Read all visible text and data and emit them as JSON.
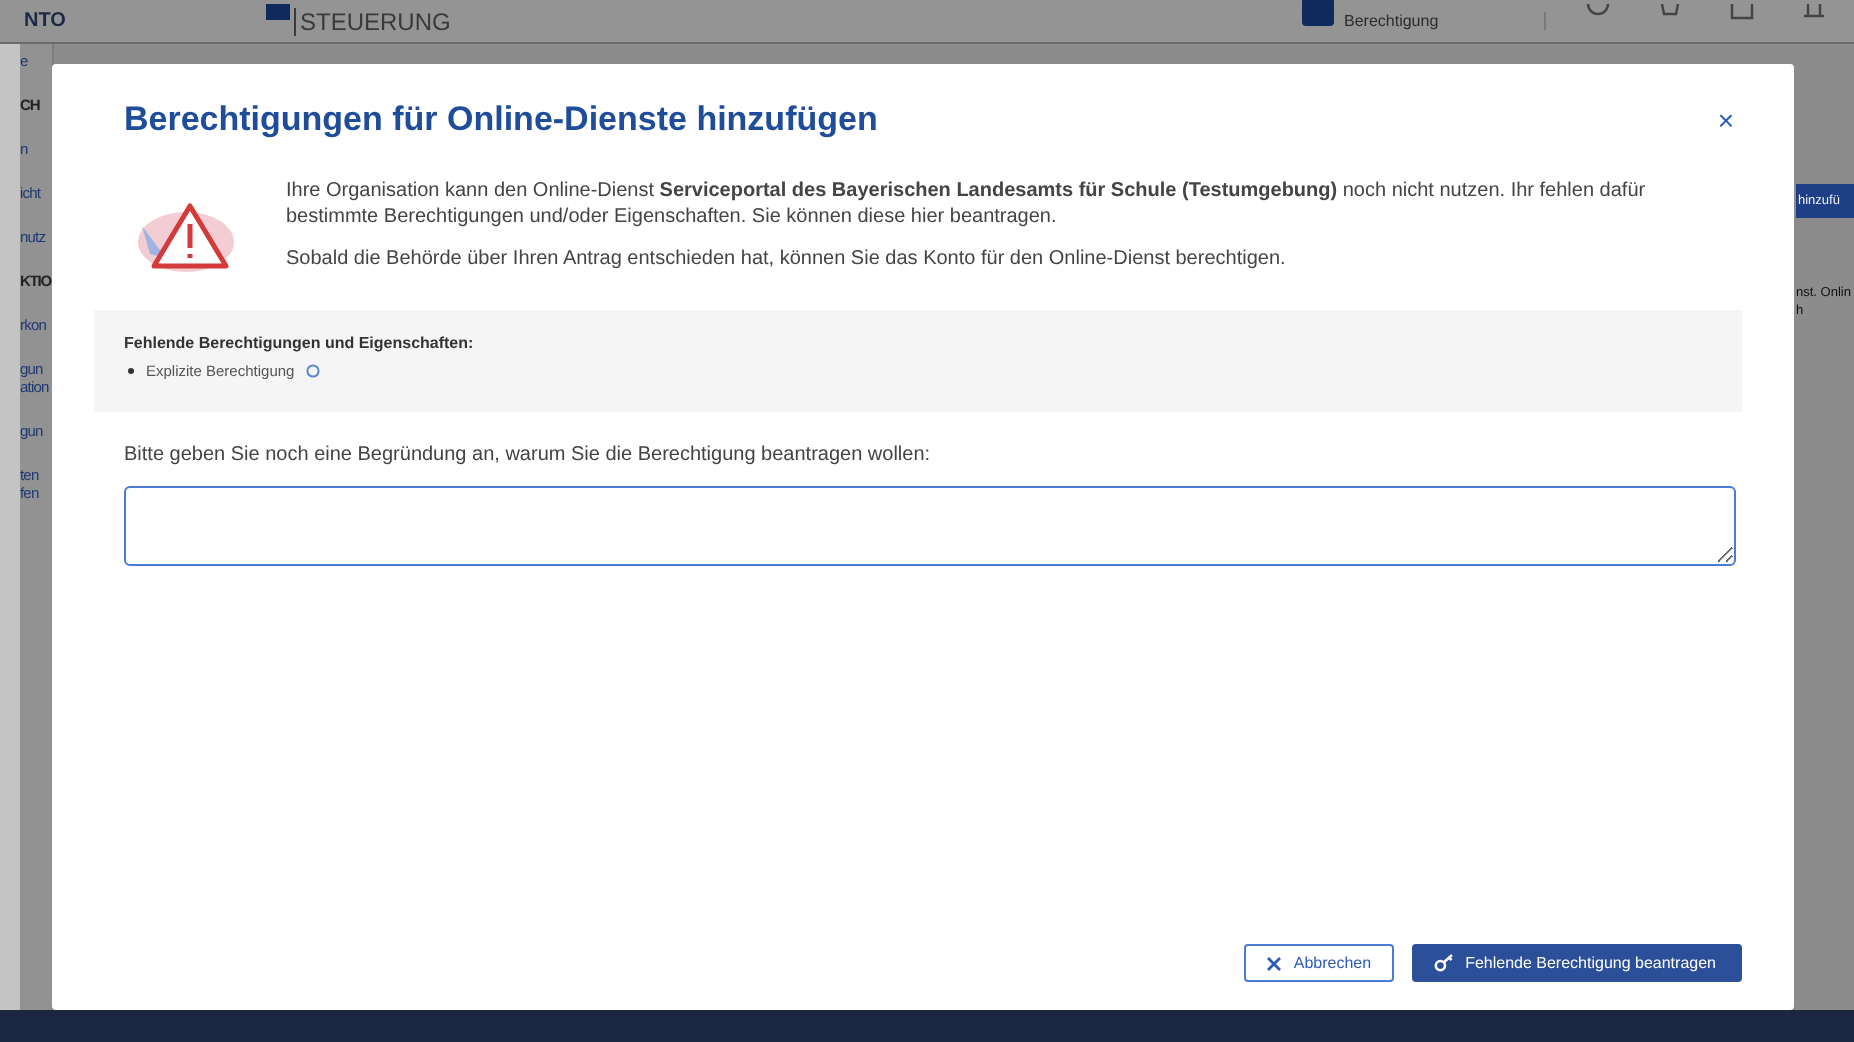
{
  "background": {
    "header": {
      "brand": "NTO",
      "product": "STEUERUNG",
      "account": "Berechtigung"
    },
    "sidebar": {
      "items": [
        {
          "kind": "link",
          "label": "e"
        },
        {
          "kind": "section",
          "label": "CH"
        },
        {
          "kind": "link",
          "label": "n"
        },
        {
          "kind": "link",
          "label": "icht"
        },
        {
          "kind": "link",
          "label": "nutz"
        },
        {
          "kind": "section",
          "label": "KTIO"
        },
        {
          "kind": "link",
          "label": "rkon"
        },
        {
          "kind": "link",
          "label": "gun ation"
        },
        {
          "kind": "link",
          "label": "gun"
        },
        {
          "kind": "link",
          "label": "ten fen"
        }
      ]
    },
    "right": {
      "button": "hinzufü",
      "lines": [
        "nst. Onlin",
        "h"
      ]
    }
  },
  "dialog": {
    "title": "Berechtigungen für Online-Dienste hinzufügen",
    "close": "×",
    "paragraphs": [
      "Ihre Organisation kann den Online-Dienst **Serviceportal des Bayerischen Landesamts für Schule (Testumgebung)** noch nicht nutzen. Ihr fehlen dafür bestimmte Berechtigungen und/oder Eigenschaften. Sie können diese hier beantragen.",
      "Sobald die Behörde über Ihren Antrag entschieden hat, können Sie das Konto für den Online-Dienst berechtigen."
    ],
    "missing": {
      "heading": "Fehlende Berechtigungen und Eigenschaften:",
      "items": [
        "Explizite Berechtigung"
      ]
    },
    "reason": {
      "label": "Bitte geben Sie noch eine Begründung an, warum Sie die Berechtigung beantragen wollen:"
    },
    "buttons": [
      {
        "kind": "secondary",
        "label": "Abbrechen"
      },
      {
        "kind": "primary",
        "label": "Fehlende Berechtigung beantragen"
      }
    ]
  }
}
